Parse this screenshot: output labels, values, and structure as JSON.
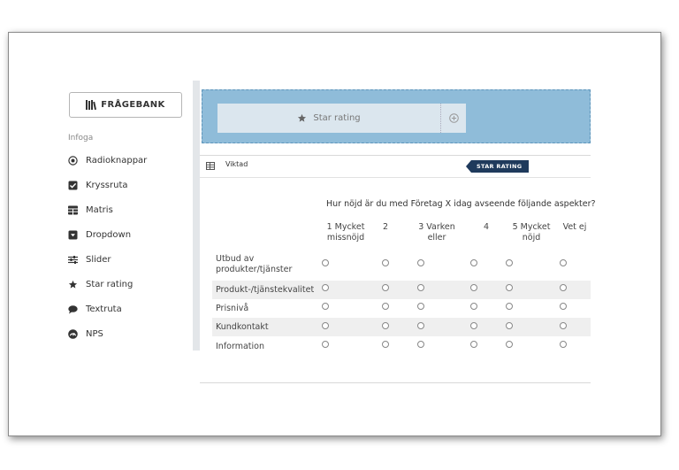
{
  "sidebar": {
    "bank_button": "FRÅGEBANK",
    "section_label": "Infoga",
    "tools": [
      {
        "label": "Radioknappar",
        "icon": "radio-icon"
      },
      {
        "label": "Kryssruta",
        "icon": "checkbox-icon"
      },
      {
        "label": "Matris",
        "icon": "matrix-icon"
      },
      {
        "label": "Dropdown",
        "icon": "dropdown-icon"
      },
      {
        "label": "Slider",
        "icon": "slider-icon"
      },
      {
        "label": "Star rating",
        "icon": "star-icon"
      },
      {
        "label": "Textruta",
        "icon": "speech-bubble-icon"
      },
      {
        "label": "NPS",
        "icon": "nps-icon"
      }
    ]
  },
  "dropzone": {
    "item_label": "Star rating",
    "item_icon": "star-icon",
    "add_icon": "plus-circle-icon"
  },
  "question": {
    "header_label": "Viktad",
    "badge": "STAR RATING",
    "text": "Hur nöjd är du med Företag X idag avseende följande aspekter?",
    "columns": [
      "1 Mycket missnöjd",
      "2",
      "3 Varken eller",
      "4",
      "5 Mycket nöjd",
      "Vet ej"
    ],
    "rows": [
      "Utbud av produkter/tjänster",
      "Produkt-/tjänstekvalitet",
      "Prisnivå",
      "Kundkontakt",
      "Information"
    ]
  },
  "colors": {
    "dropzone_bg": "#8fbcd9",
    "badge_bg": "#1f3a5c",
    "row_shade": "#efefef"
  }
}
